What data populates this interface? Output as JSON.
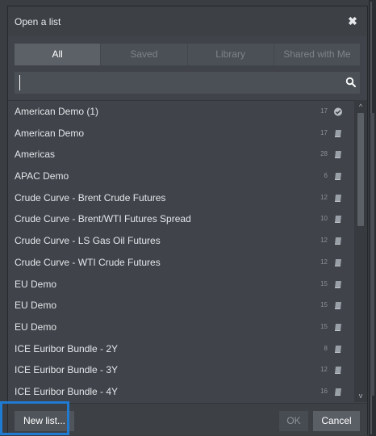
{
  "dialog": {
    "title": "Open a list",
    "close_glyph": "✖"
  },
  "tabs": [
    {
      "label": "All",
      "active": true
    },
    {
      "label": "Saved",
      "active": false
    },
    {
      "label": "Library",
      "active": false
    },
    {
      "label": "Shared with Me",
      "active": false
    }
  ],
  "search": {
    "value": "",
    "placeholder": "",
    "icon": "search-icon"
  },
  "lists": [
    {
      "name": "American Demo (1)",
      "count": "17",
      "icon": "check-circle-icon"
    },
    {
      "name": "American Demo",
      "count": "17",
      "icon": "book-icon"
    },
    {
      "name": "Americas",
      "count": "28",
      "icon": "book-icon"
    },
    {
      "name": "APAC Demo",
      "count": "6",
      "icon": "book-icon"
    },
    {
      "name": "Crude Curve - Brent Crude Futures",
      "count": "12",
      "icon": "book-icon"
    },
    {
      "name": "Crude Curve - Brent/WTI Futures Spread",
      "count": "10",
      "icon": "book-icon"
    },
    {
      "name": "Crude Curve - LS Gas Oil Futures",
      "count": "12",
      "icon": "book-icon"
    },
    {
      "name": "Crude Curve - WTI Crude Futures",
      "count": "12",
      "icon": "book-icon"
    },
    {
      "name": "EU Demo",
      "count": "15",
      "icon": "book-icon"
    },
    {
      "name": "EU Demo",
      "count": "15",
      "icon": "book-icon"
    },
    {
      "name": "EU Demo",
      "count": "15",
      "icon": "book-icon"
    },
    {
      "name": "ICE Euribor Bundle - 2Y",
      "count": "8",
      "icon": "book-icon"
    },
    {
      "name": "ICE Euribor Bundle - 3Y",
      "count": "12",
      "icon": "book-icon"
    },
    {
      "name": "ICE Euribor Bundle - 4Y",
      "count": "16",
      "icon": "book-icon"
    }
  ],
  "scrollbar": {
    "up_glyph": "^",
    "down_glyph": "v"
  },
  "footer": {
    "new_list_label": "New list...",
    "ok_label": "OK",
    "cancel_label": "Cancel"
  },
  "colors": {
    "highlight": "#1f7ad1",
    "background": "#40444a"
  }
}
